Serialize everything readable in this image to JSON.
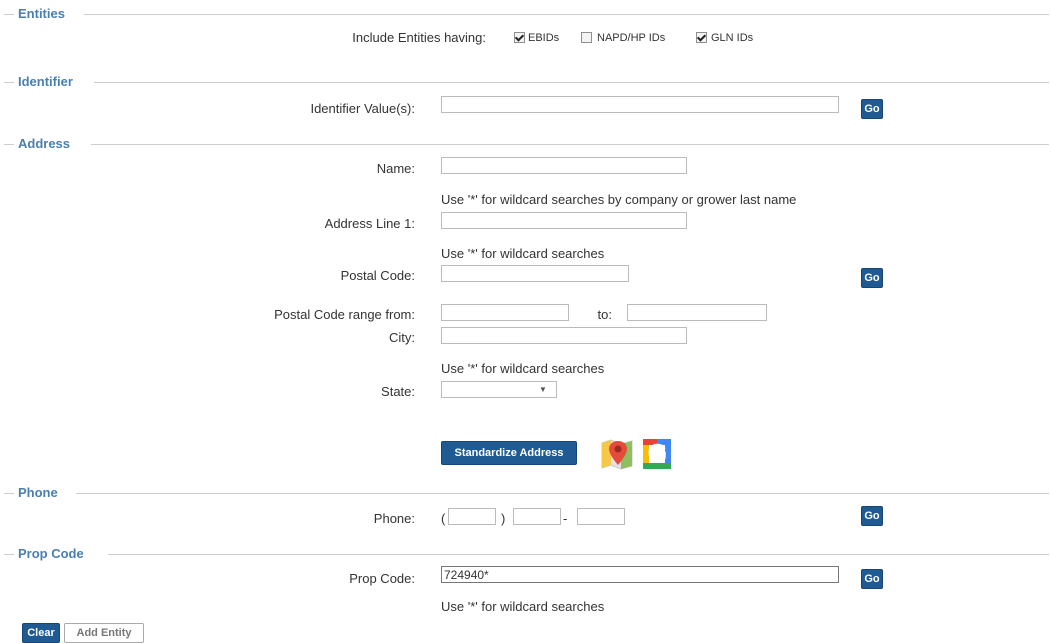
{
  "entities": {
    "title": "Entities",
    "include_label": "Include Entities having:",
    "options": [
      {
        "label": "EBIDs",
        "checked": true
      },
      {
        "label": "NAPD/HP IDs",
        "checked": false
      },
      {
        "label": "GLN IDs",
        "checked": true
      }
    ]
  },
  "identifier": {
    "title": "Identifier",
    "label": "Identifier Value(s):",
    "value": "",
    "go_label": "Go"
  },
  "address": {
    "title": "Address",
    "name_label": "Name:",
    "name_hint": "Use '*' for wildcard searches by company or grower last name",
    "address1_label": "Address Line 1:",
    "address1_hint": "Use '*' for wildcard searches",
    "postal_label": "Postal Code:",
    "postal_range_label": "Postal Code range from:",
    "to_label": "to:",
    "city_label": "City:",
    "city_hint": "Use '*' for wildcard searches",
    "state_label": "State:",
    "state_value": "",
    "go_label": "Go",
    "standardize_label": "Standardize Address",
    "map_icon": "map-pin-icon",
    "google_icon": "google-icon",
    "google_letter": "G",
    "google_colors": [
      "#ea4335",
      "#fbbc05",
      "#34a853",
      "#4285f4"
    ]
  },
  "phone": {
    "title": "Phone",
    "label": "Phone:",
    "open_paren": "(",
    "close_paren": ")",
    "dash": "-",
    "go_label": "Go"
  },
  "prop_code": {
    "title": "Prop Code",
    "label": "Prop Code:",
    "value": "724940*",
    "hint": "Use '*' for wildcard searches",
    "go_label": "Go"
  },
  "actions": {
    "clear_label": "Clear",
    "add_entity_label": "Add Entity"
  },
  "colors": {
    "section_title": "#4a7fb0",
    "button_blue": "#1f5a92",
    "rule": "#cccccc"
  }
}
